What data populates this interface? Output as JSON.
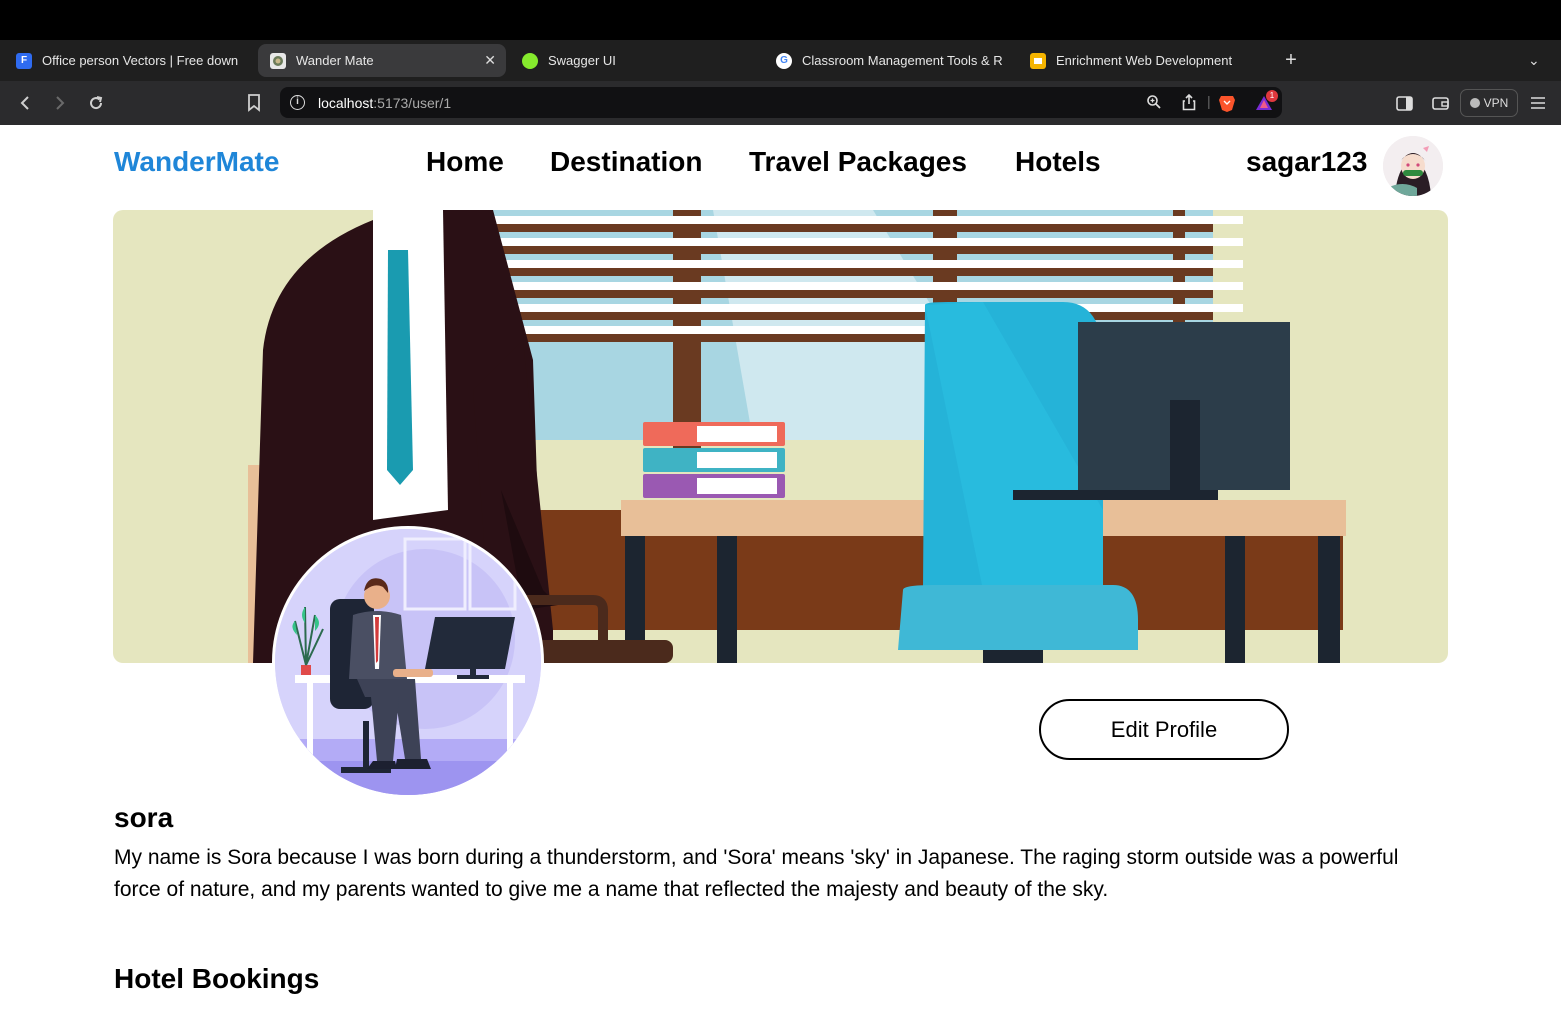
{
  "browser": {
    "tabs": [
      {
        "title": "Office person Vectors | Free down",
        "favicon_color": "#2f6bf0",
        "favicon_glyph": "F"
      },
      {
        "title": "Wander Mate",
        "favicon_color": "#6b7b5a",
        "favicon_glyph": "",
        "active": true
      },
      {
        "title": "Swagger UI",
        "favicon_color": "#85ea2d",
        "favicon_glyph": ""
      },
      {
        "title": "Classroom Management Tools & R",
        "favicon_color": "#ffffff",
        "favicon_glyph": "G"
      },
      {
        "title": "Enrichment Web Development",
        "favicon_color": "#f4b400",
        "favicon_glyph": ""
      }
    ],
    "address": {
      "host": "localhost",
      "path": ":5173/user/1"
    },
    "vpn_label": "VPN",
    "brave_badge": "1"
  },
  "site": {
    "logo": "WanderMate",
    "nav": [
      "Home",
      "Destination",
      "Travel Packages",
      "Hotels"
    ],
    "username": "sagar123",
    "accent": "#1f86d8"
  },
  "profile": {
    "edit_label": "Edit Profile",
    "name": "sora",
    "bio": "My name is Sora because I was born during a thunderstorm, and 'Sora' means 'sky' in Japanese. The raging storm outside was a powerful force of nature, and my parents wanted to give me a name that reflected the majesty and beauty of the sky.",
    "section_title": "Hotel Bookings"
  }
}
